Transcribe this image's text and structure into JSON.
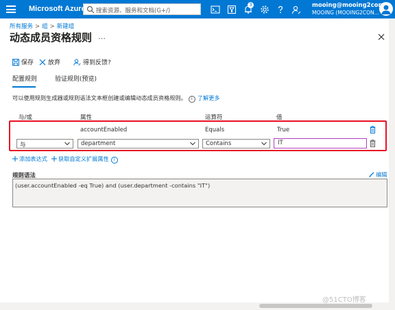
{
  "topbar": {
    "brand": "Microsoft Azure",
    "search_placeholder": "搜索资源、服务和文档(G+/)",
    "notification_count": "3",
    "user_email": "mooing@mooing2con...",
    "user_tenant": "MOOING (MOOING2CON...",
    "icons": [
      "cloud-shell-icon",
      "directory-filter-icon",
      "notifications-icon",
      "settings-icon",
      "help-icon",
      "feedback-icon"
    ]
  },
  "breadcrumb": {
    "items": [
      "所有服务",
      "组",
      "新建组"
    ],
    "separator": ">"
  },
  "page": {
    "title": "动态成员资格规则",
    "more": "…"
  },
  "toolbar": {
    "save": "保存",
    "discard": "放弃",
    "feedback": "得到反馈?"
  },
  "tabs": {
    "configure": "配置规则",
    "validate": "验证规则(预览)"
  },
  "description": {
    "text": "可以使用规则生成器或规则语法文本框创建或编辑动态成员资格规则。",
    "link": "了解更多"
  },
  "rules": {
    "headers": {
      "andor": "与/或",
      "property": "属性",
      "operator": "运算符",
      "value": "值"
    },
    "row1": {
      "property": "accountEnabled",
      "operator": "Equals",
      "value": "True"
    },
    "row2": {
      "andor": "与",
      "property": "department",
      "operator": "Contains",
      "value": "IT"
    }
  },
  "actions": {
    "add_expression": "添加表达式",
    "get_custom_extension": "获取自定义扩展属性"
  },
  "syntax": {
    "label": "规则语法",
    "edit": "编辑",
    "value": "(user.accountEnabled -eq True) and (user.department -contains \"IT\")"
  },
  "watermark": "@51CTO博客",
  "colors": {
    "accent": "#0078d4",
    "highlight_border": "#e81123"
  }
}
